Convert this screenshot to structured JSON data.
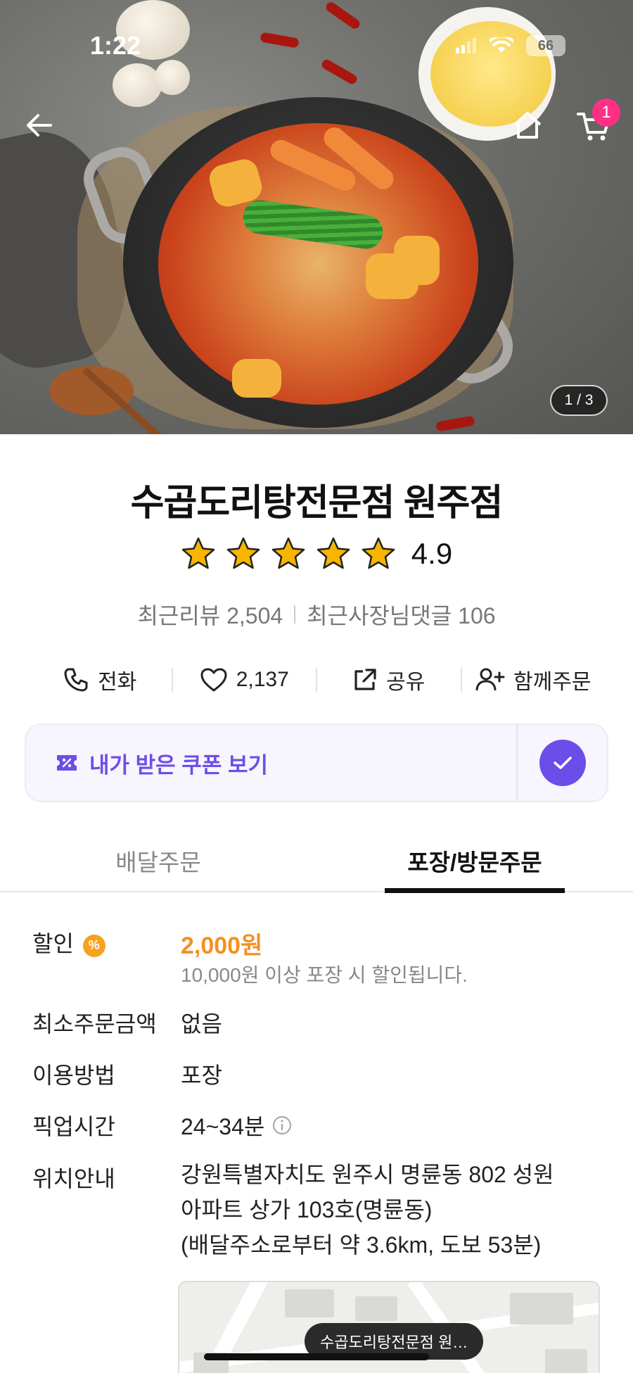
{
  "status_bar": {
    "time": "1:22",
    "battery": "66"
  },
  "hero": {
    "page_indicator": "1 / 3",
    "cart_count": "1"
  },
  "store": {
    "name": "수곱도리탕전문점 원주점",
    "rating": "4.9",
    "stars": 5,
    "recent_reviews": "최근리뷰 2,504",
    "owner_replies": "최근사장님댓글 106"
  },
  "actions": {
    "call": "전화",
    "likes": "2,137",
    "share": "공유",
    "group_order": "함께주문"
  },
  "coupon": {
    "label": "내가 받은 쿠폰 보기"
  },
  "tabs": {
    "delivery": "배달주문",
    "pickup": "포장/방문주문"
  },
  "details": {
    "discount_label": "할인",
    "discount_value": "2,000원",
    "discount_note": "10,000원 이상 포장 시 할인됩니다.",
    "min_order_label": "최소주문금액",
    "min_order_value": "없음",
    "method_label": "이용방법",
    "method_value": "포장",
    "pickup_time_label": "픽업시간",
    "pickup_time_value": "24~34분",
    "location_label": "위치안내",
    "address_line1": "강원특별자치도 원주시 명륜동 802 성원",
    "address_line2": "아파트 상가 103호(명륜동)",
    "address_line3": "(배달주소로부터 약 3.6km, 도보 53분)"
  },
  "map": {
    "pin_label": "수곱도리탕전문점 원…"
  },
  "colors": {
    "accent_purple": "#6b4de8",
    "discount_orange": "#f39121",
    "badge_pink": "#ff2f86",
    "star_yellow": "#f7b500"
  },
  "icons": [
    "back-arrow-icon",
    "home-icon",
    "cart-icon",
    "phone-icon",
    "heart-icon",
    "share-icon",
    "add-user-icon",
    "coupon-icon",
    "check-icon",
    "percent-icon",
    "info-icon",
    "star-icon"
  ]
}
